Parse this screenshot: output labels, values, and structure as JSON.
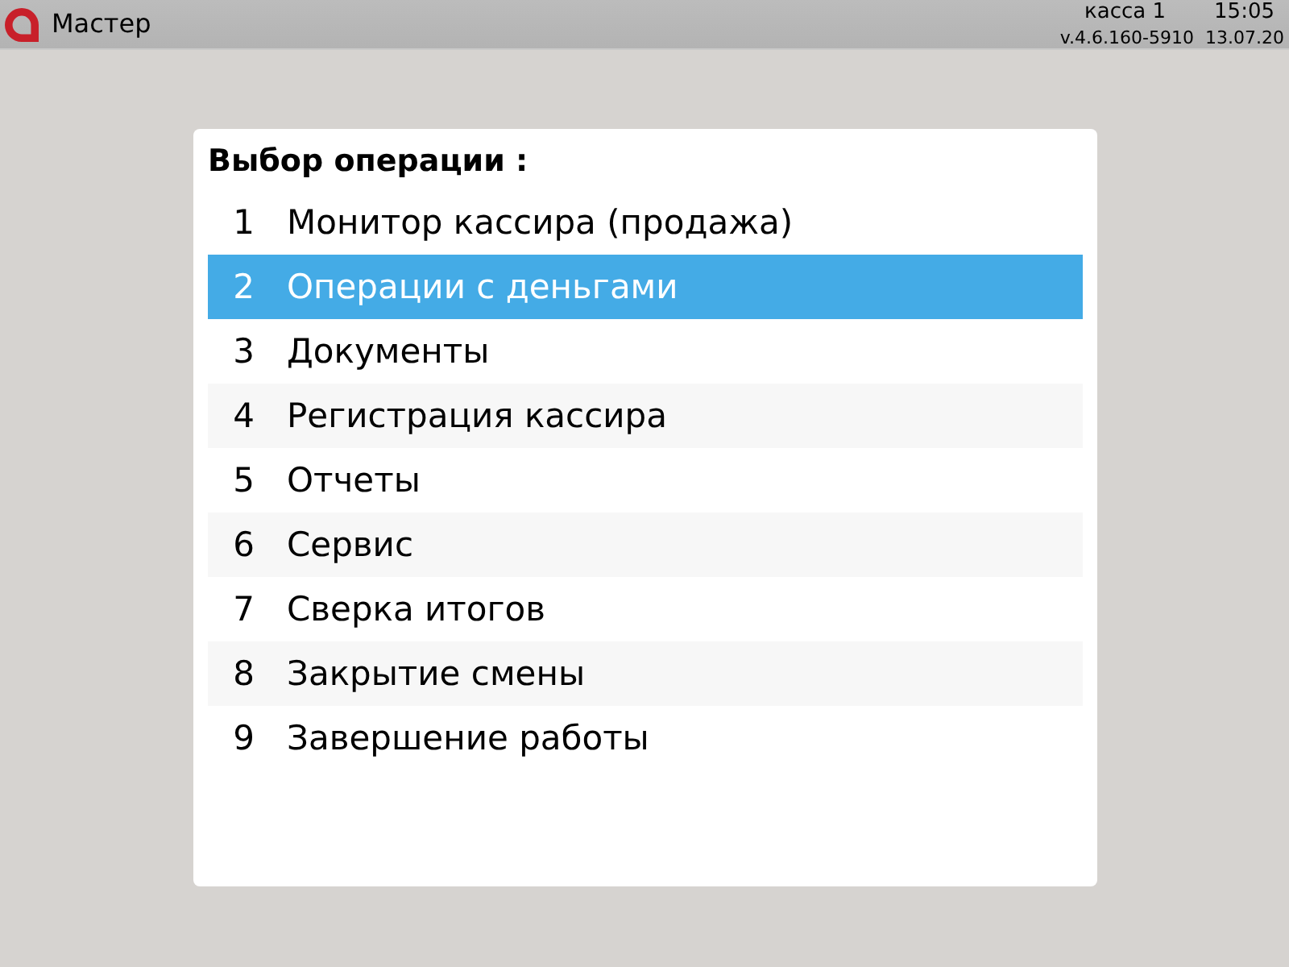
{
  "top_bar": {
    "title": "Мастер",
    "register": "касса 1",
    "time": "15:05",
    "version": "v.4.6.160-5910",
    "date": "13.07.20"
  },
  "menu": {
    "title": "Выбор операции :",
    "items": [
      {
        "number": "1",
        "label": "Монитор кассира (продажа)",
        "selected": false
      },
      {
        "number": "2",
        "label": "Операции с деньгами",
        "selected": true
      },
      {
        "number": "3",
        "label": "Документы",
        "selected": false
      },
      {
        "number": "4",
        "label": "Регистрация кассира",
        "selected": false
      },
      {
        "number": "5",
        "label": "Отчеты",
        "selected": false
      },
      {
        "number": "6",
        "label": "Сервис",
        "selected": false
      },
      {
        "number": "7",
        "label": "Сверка итогов",
        "selected": false
      },
      {
        "number": "8",
        "label": "Закрытие смены",
        "selected": false
      },
      {
        "number": "9",
        "label": "Завершение работы",
        "selected": false
      }
    ]
  }
}
